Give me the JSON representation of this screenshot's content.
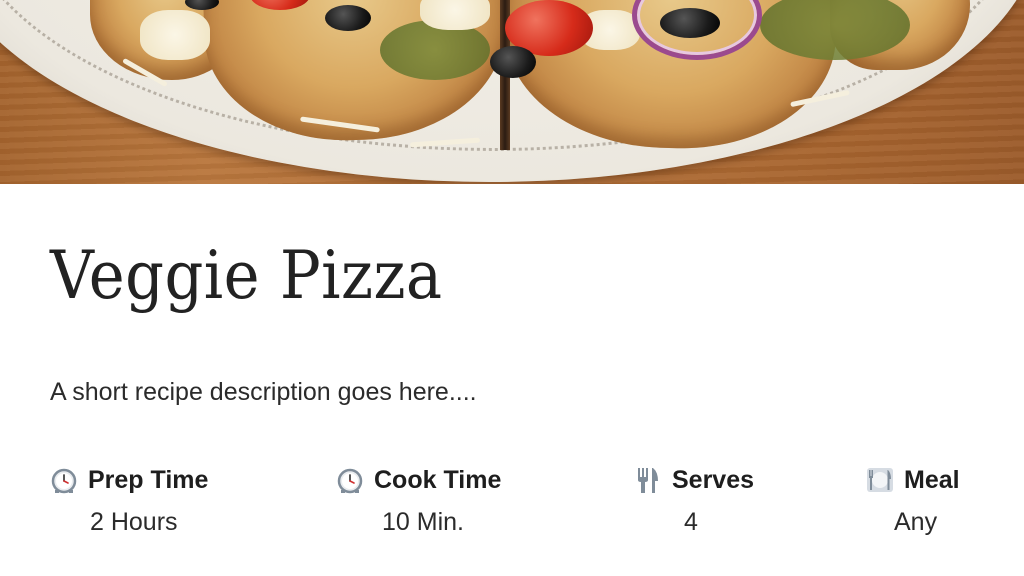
{
  "recipe": {
    "title": "Veggie Pizza",
    "description": "A short recipe description goes here...."
  },
  "meta": [
    {
      "icon": "alarm-clock-icon",
      "label": "Prep Time",
      "value": "2 Hours"
    },
    {
      "icon": "alarm-clock-icon",
      "label": "Cook Time",
      "value": "10 Min."
    },
    {
      "icon": "fork-knife-icon",
      "label": "Serves",
      "value": "4"
    },
    {
      "icon": "fork-knife-plate-icon",
      "label": "Meal",
      "value": "Any"
    }
  ],
  "colors": {
    "text": "#222222",
    "table_wood": "#b26f37",
    "plate": "#ece8df",
    "icon_gray": "#7f8c99"
  }
}
